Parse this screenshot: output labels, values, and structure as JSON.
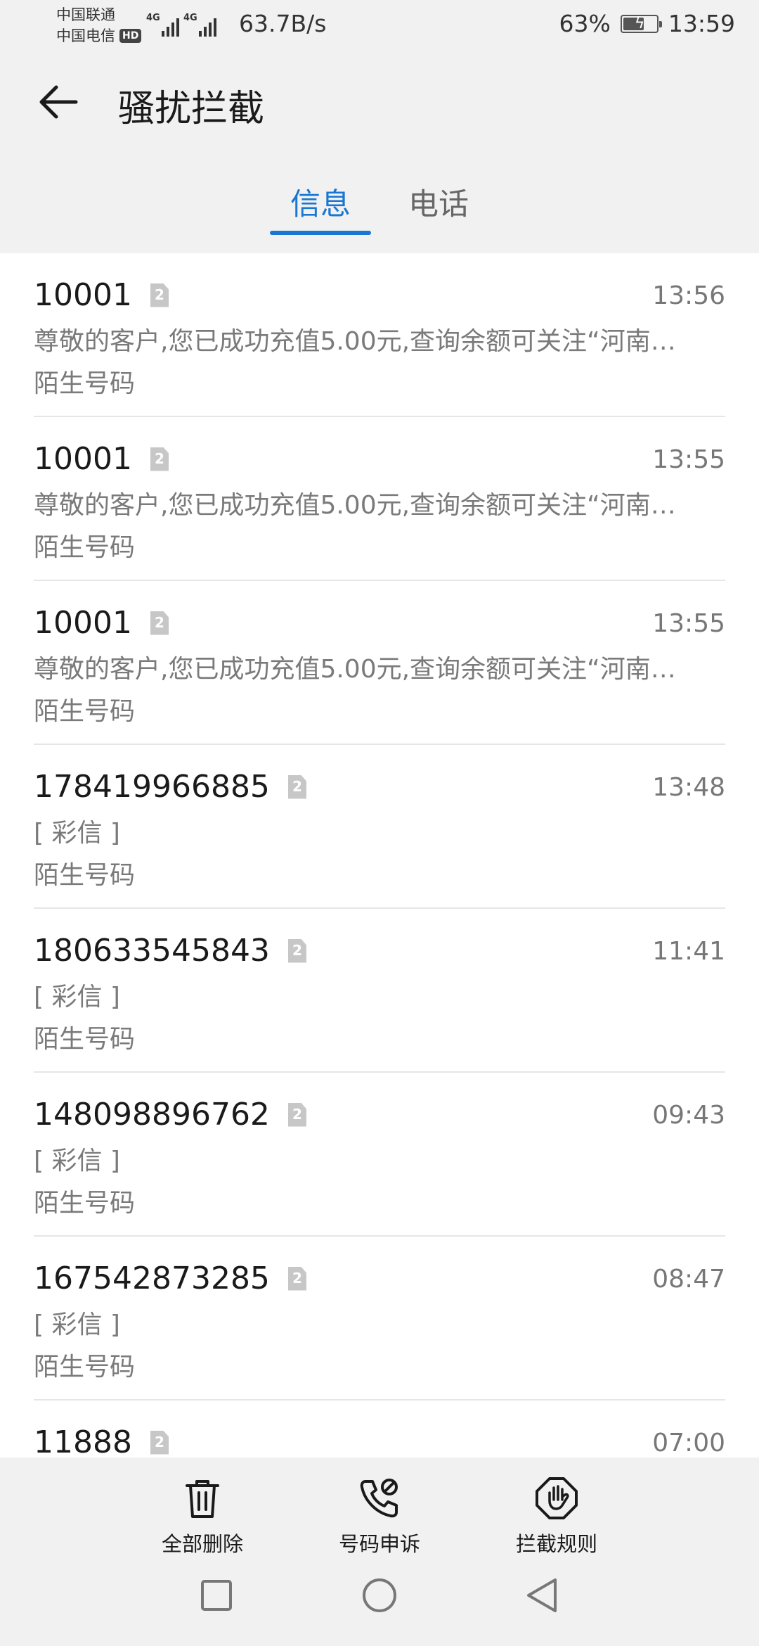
{
  "status_bar": {
    "carrier_1": "中国联通",
    "carrier_2": "中国电信",
    "hd_badge": "HD",
    "network_1": "4G",
    "network_2": "4G",
    "net_speed": "63.7B/s",
    "battery_percent": "63%",
    "battery_level": 0.63,
    "clock": "13:59"
  },
  "header": {
    "title": "骚扰拦截"
  },
  "tabs": [
    {
      "label": "信息",
      "active": true
    },
    {
      "label": "电话",
      "active": false
    }
  ],
  "sim_badge": "2",
  "messages": [
    {
      "sender": "10001",
      "time": "13:56",
      "preview": "尊敬的客户,您已成功充值5.00元,查询余额可关注“河南…",
      "tag": "陌生号码"
    },
    {
      "sender": "10001",
      "time": "13:55",
      "preview": "尊敬的客户,您已成功充值5.00元,查询余额可关注“河南…",
      "tag": "陌生号码"
    },
    {
      "sender": "10001",
      "time": "13:55",
      "preview": "尊敬的客户,您已成功充值5.00元,查询余额可关注“河南…",
      "tag": "陌生号码"
    },
    {
      "sender": "178419966885",
      "time": "13:48",
      "preview": "[ 彩信 ]",
      "tag": "陌生号码"
    },
    {
      "sender": "180633545843",
      "time": "11:41",
      "preview": "[ 彩信 ]",
      "tag": "陌生号码"
    },
    {
      "sender": "148098896762",
      "time": "09:43",
      "preview": "[ 彩信 ]",
      "tag": "陌生号码"
    },
    {
      "sender": "167542873285",
      "time": "08:47",
      "preview": "[ 彩信 ]",
      "tag": "陌生号码"
    },
    {
      "sender": "11888",
      "time": "07:00",
      "preview": "",
      "tag": ""
    }
  ],
  "toolbar": {
    "delete_all": "全部删除",
    "number_appeal": "号码申诉",
    "block_rules": "拦截规则"
  },
  "icons": {
    "back": "arrow-left-icon",
    "delete": "trash-icon",
    "appeal": "phone-blocked-icon",
    "rules": "hand-stop-icon",
    "sim": "sim-card-icon"
  }
}
